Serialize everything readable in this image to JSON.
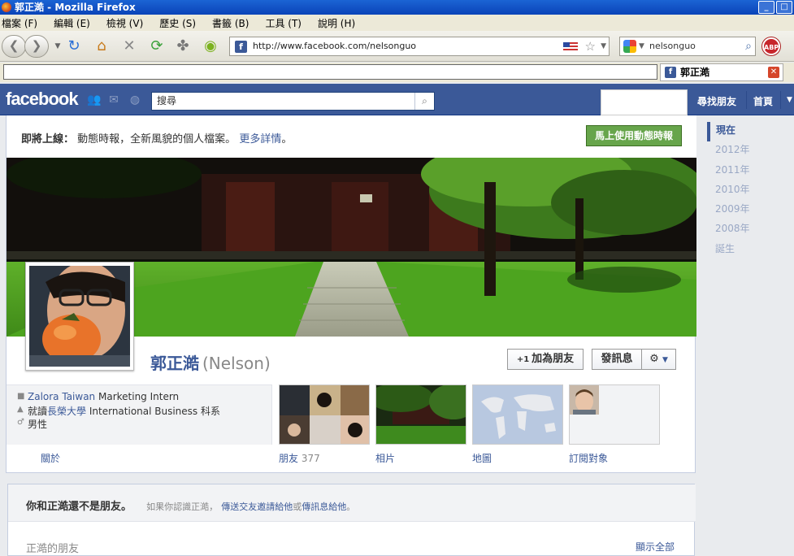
{
  "window": {
    "title": "郭正澔 - Mozilla Firefox",
    "buttons": [
      "_",
      "□"
    ]
  },
  "menu": [
    "檔案 (F)",
    "編輯 (E)",
    "檢視 (V)",
    "歷史 (S)",
    "書籤 (B)",
    "工具 (T)",
    "說明 (H)"
  ],
  "browser": {
    "url": "http://www.facebook.com/nelsonguo",
    "search_value": "nelsonguo",
    "abp_label": "ABP",
    "tab_title": "郭正澔"
  },
  "fb": {
    "logo": "facebook",
    "search_placeholder": "搜尋",
    "nav_find_friends": "尋找朋友",
    "nav_home": "首頁"
  },
  "promo": {
    "lead": "即將上線：",
    "text": "動態時報，全新風貌的個人檔案。",
    "more": "更多詳情",
    "period": "。",
    "button": "馬上使用動態時報"
  },
  "profile": {
    "name": "郭正澔",
    "alt_name": "(Nelson)",
    "add_friend": "加為朋友",
    "add_friend_icon": "+1",
    "message": "發訊息",
    "gear_icon": "⚙"
  },
  "info": {
    "work_company": "Zalora Taiwan",
    "work_title": "Marketing Intern",
    "edu_prefix": "就讀",
    "edu_school": "長榮大學",
    "edu_field": "International Business 科系",
    "gender": "男性",
    "about": "關於"
  },
  "tiles": {
    "friends_label": "朋友",
    "friends_count": "377",
    "photos_label": "相片",
    "map_label": "地圖",
    "subscriptions_label": "訂閱對象"
  },
  "lower": {
    "not_friends": "你和正澔還不是朋友。",
    "if_know": "如果你認識正澔，",
    "send_request": "傳送交友邀請給他",
    "or": "或",
    "send_message": "傳訊息給他",
    "end": "。",
    "friends_heading": "正澔的朋友",
    "show_all": "顯示全部"
  },
  "years": [
    "現在",
    "2012年",
    "2011年",
    "2010年",
    "2009年",
    "2008年",
    "誕生"
  ],
  "colors": {
    "fb_blue": "#3b5998",
    "green_button": "#67a54b"
  }
}
